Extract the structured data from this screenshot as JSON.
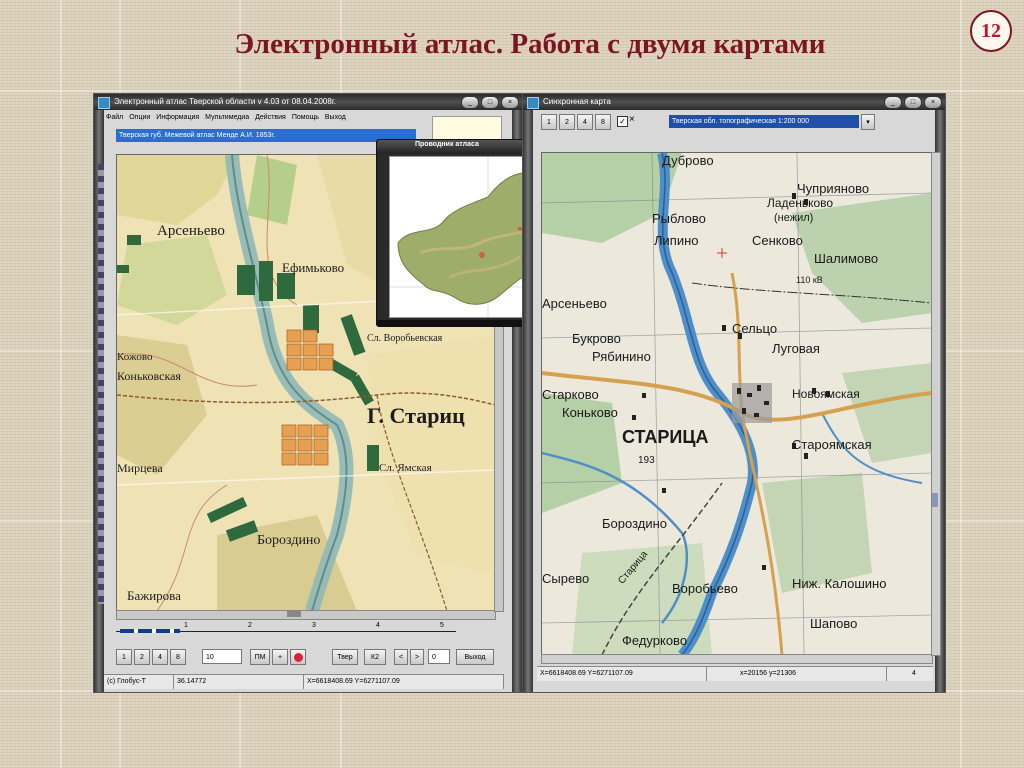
{
  "slide": {
    "title": "Электронный атлас. Работа с двумя картами",
    "page_number": "12"
  },
  "left_window": {
    "title": "Электронный атлас Тверской области v 4.03 от 08.04.2008г.",
    "menu": [
      "Файл",
      "Опции",
      "Информация",
      "Мультимедиа",
      "Действия",
      "Помощь",
      "Выход"
    ],
    "layer_field": "Тверская губ. Межевой атлас Менде А.И. 1853г.",
    "scale_ticks": [
      "1",
      "2",
      "3",
      "4",
      "5"
    ],
    "zoom_buttons": [
      "1",
      "2",
      "4",
      "8"
    ],
    "zoom_value": "10",
    "buttons": {
      "pm": "ПМ",
      "plus": "+",
      "tver": "Твер",
      "k2": "К2",
      "back": "<",
      "forward": ">",
      "exit": "Выход"
    },
    "counter_value": "0",
    "status": {
      "globe": "(c) Глобус-Т",
      "value": "36.14772",
      "coords": "X=6618408.69 Y=6271107.09"
    },
    "map_labels": [
      "Арсеньево",
      "Ефимьково",
      "Коньковская",
      "Кожово",
      "Бажирова",
      "Сл. Воробьевская",
      "Г. Стариц",
      "Сл. Ямская",
      "Бороздино",
      "Мирцева"
    ]
  },
  "navigator": {
    "title": "Проводник атласа"
  },
  "right_window": {
    "title": "Синхронная карта",
    "zoom_buttons": [
      "1",
      "2",
      "4",
      "8"
    ],
    "layer_field": "Тверская обл. топографическая 1:200 000",
    "status": {
      "coords": "X=6618408.69 Y=6271107.09",
      "xy": "x=20156 y=21306",
      "page": "4"
    },
    "map_labels": [
      "Дуброво",
      "Чуприяново",
      "Ладеньково",
      "(нежил)",
      "Рыблово",
      "Липино",
      "Сенково",
      "Шалимово",
      "Арсеньево",
      "Сельцо",
      "Луговая",
      "Букрово",
      "Рябинино",
      "Старково",
      "Коньково",
      "Новоямская",
      "СТАРИЦА",
      "Староямская",
      "Бороздино",
      "Сырево",
      "Воробьево",
      "Ниж. Калошино",
      "Шапово",
      "Федурково",
      "110 кВ",
      "193",
      "Старица"
    ]
  }
}
